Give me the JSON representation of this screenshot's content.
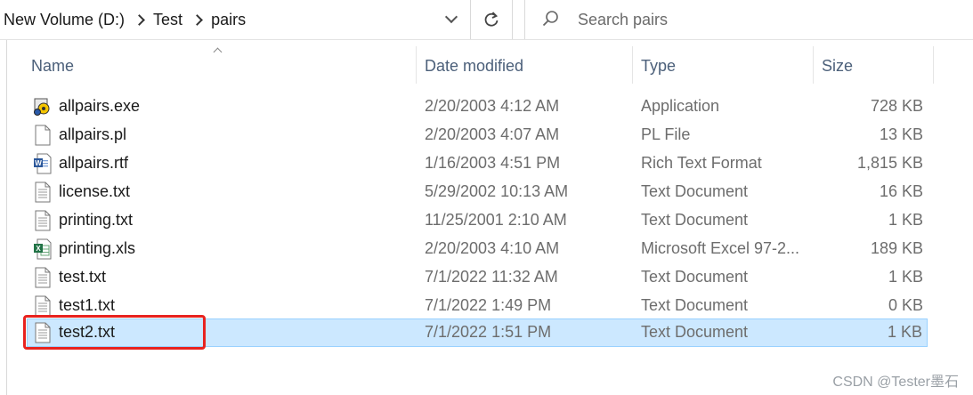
{
  "address_bar": {
    "breadcrumbs": [
      "New Volume (D:)",
      "Test",
      "pairs"
    ],
    "dropdown_icon": "chevron-down-icon",
    "refresh_icon": "refresh-icon"
  },
  "search": {
    "placeholder": "Search pairs",
    "icon": "search-icon"
  },
  "columns": {
    "name": "Name",
    "date": "Date modified",
    "type": "Type",
    "size": "Size",
    "sorted_by": "Name"
  },
  "files": [
    {
      "name": "allpairs.exe",
      "date": "2/20/2003 4:12 AM",
      "type": "Application",
      "size": "728 KB",
      "icon": "exe-icon"
    },
    {
      "name": "allpairs.pl",
      "date": "2/20/2003 4:07 AM",
      "type": "PL File",
      "size": "13 KB",
      "icon": "blank-file-icon"
    },
    {
      "name": "allpairs.rtf",
      "date": "1/16/2003 4:51 PM",
      "type": "Rich Text Format",
      "size": "1,815 KB",
      "icon": "word-doc-icon"
    },
    {
      "name": "license.txt",
      "date": "5/29/2002 10:13 AM",
      "type": "Text Document",
      "size": "16 KB",
      "icon": "text-file-icon"
    },
    {
      "name": "printing.txt",
      "date": "11/25/2001 2:10 AM",
      "type": "Text Document",
      "size": "1 KB",
      "icon": "text-file-icon"
    },
    {
      "name": "printing.xls",
      "date": "2/20/2003 4:10 AM",
      "type": "Microsoft Excel 97-2...",
      "size": "189 KB",
      "icon": "excel-icon"
    },
    {
      "name": "test.txt",
      "date": "7/1/2022 11:32 AM",
      "type": "Text Document",
      "size": "1 KB",
      "icon": "text-file-icon"
    },
    {
      "name": "test1.txt",
      "date": "7/1/2022 1:49 PM",
      "type": "Text Document",
      "size": "0 KB",
      "icon": "text-file-icon"
    },
    {
      "name": "test2.txt",
      "date": "7/1/2022 1:51 PM",
      "type": "Text Document",
      "size": "1 KB",
      "icon": "text-file-icon",
      "selected": true
    }
  ],
  "colors": {
    "selection_bg": "#cce8ff",
    "selection_border": "#99d1ff",
    "highlight": "#e8231f",
    "header_text": "#4c607a"
  },
  "watermark": "CSDN @Tester墨石"
}
